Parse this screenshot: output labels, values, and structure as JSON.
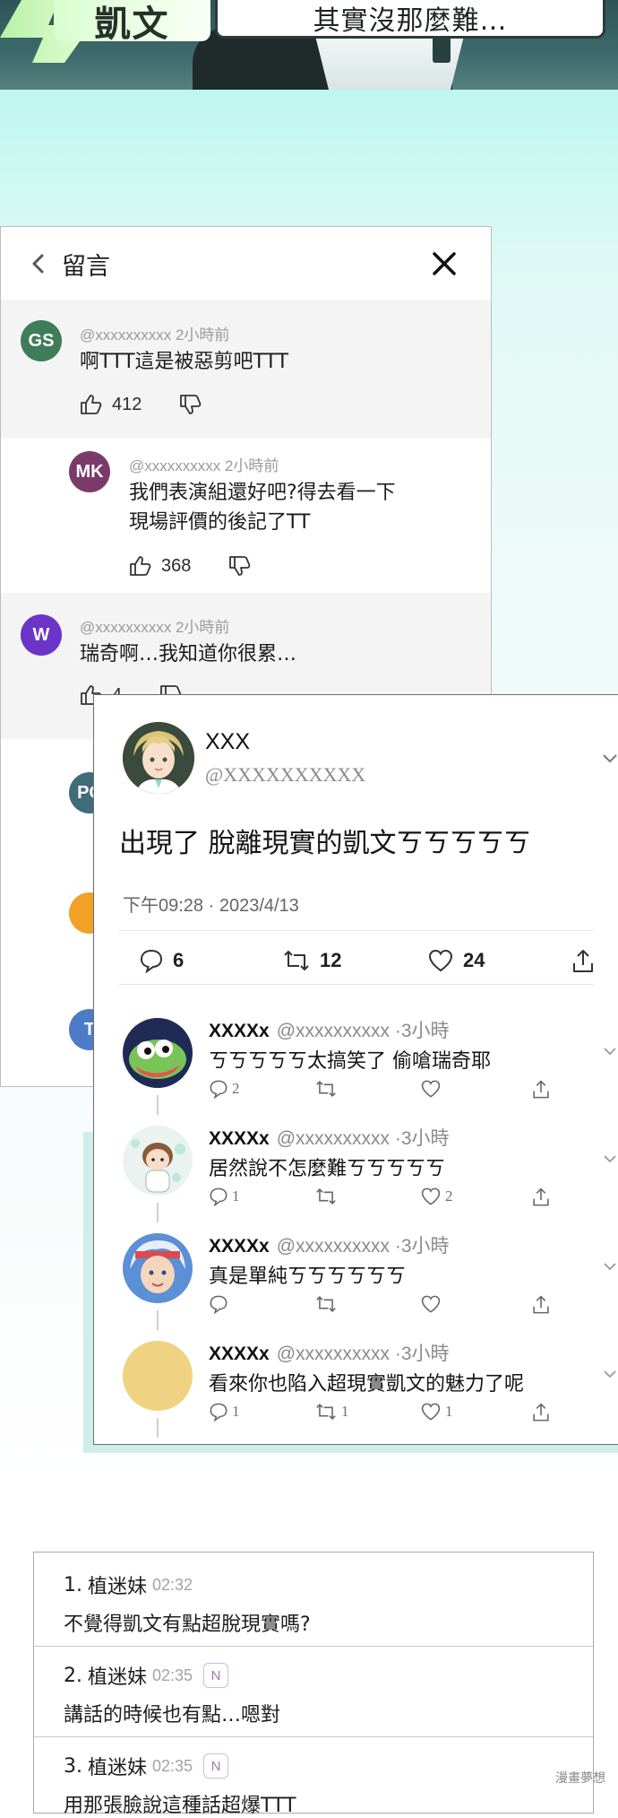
{
  "top": {
    "speaker_name": "凱文",
    "speech": "其實沒那麼難…"
  },
  "comments": {
    "title": "留言",
    "items": [
      {
        "initials": "GS",
        "color": "#3f7c59",
        "meta": "@xxxxxxxxxx 2小時前",
        "lines": [
          "啊TTT這是被惡剪吧TTT"
        ],
        "likes": "412"
      },
      {
        "initials": "MK",
        "color": "#7a3b6a",
        "meta": "@xxxxxxxxxx 2小時前",
        "lines": [
          "我們表演組還好吧?得去看一下",
          "現場評價的後記了TT"
        ],
        "likes": "368"
      },
      {
        "initials": "W",
        "color": "#6a35c8",
        "meta": "@xxxxxxxxxx 2小時前",
        "lines": [
          "瑞奇啊…我知道你很累…"
        ],
        "likes": "4"
      }
    ],
    "partial_avatars": [
      {
        "initials": "PC",
        "color": "#3f6c78"
      },
      {
        "initials": "",
        "color": "#f0a126"
      },
      {
        "initials": "T",
        "color": "#4d7bc7"
      }
    ]
  },
  "tweet": {
    "name": "XXX",
    "handle": "@XXXXXXXXXX",
    "text": "出現了 脫離現實的凱文ㄎㄎㄎㄎㄎ",
    "time": "下午09:28 · 2023/4/13",
    "replies_count": "6",
    "retweets_count": "12",
    "likes_count": "24",
    "replies": [
      {
        "name": "XXXXx",
        "handle": "@xxxxxxxxxx ·3小時",
        "text": "ㄎㄎㄎㄎㄎ太搞笑了 偷嗆瑞奇耶",
        "reply_n": "2",
        "rt_n": "",
        "like_n": ""
      },
      {
        "name": "XXXXx",
        "handle": "@xxxxxxxxxx ·3小時",
        "text": "居然說不怎麼難ㄎㄎㄎㄎㄎ",
        "reply_n": "1",
        "rt_n": "",
        "like_n": "2"
      },
      {
        "name": "XXXXx",
        "handle": "@xxxxxxxxxx ·3小時",
        "text": "真是單純ㄎㄎㄎㄎㄎㄎ",
        "reply_n": "",
        "rt_n": "",
        "like_n": ""
      },
      {
        "name": "XXXXx",
        "handle": "@xxxxxxxxxx ·3小時",
        "text": "看來你也陷入超現實凱文的魅力了呢",
        "reply_n": "1",
        "rt_n": "1",
        "like_n": "1"
      }
    ]
  },
  "chat": {
    "rows": [
      {
        "num": "1.",
        "user": "植迷妹",
        "time": "02:32",
        "badge": "",
        "text": "不覺得凱文有點超脫現實嗎?"
      },
      {
        "num": "2.",
        "user": "植迷妹",
        "time": "02:35",
        "badge": "N",
        "text": "講話的時候也有點…嗯對"
      },
      {
        "num": "3.",
        "user": "植迷妹",
        "time": "02:35",
        "badge": "N",
        "text": "用那張臉說這種話超爆TTT"
      }
    ]
  },
  "watermark": "漫畫夢想"
}
